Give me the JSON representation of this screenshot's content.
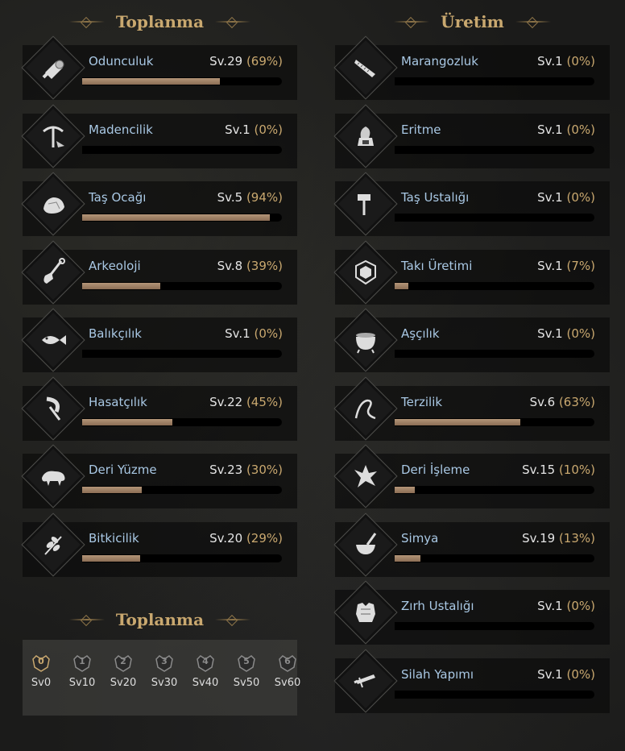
{
  "sections": {
    "gathering_title": "Toplanma",
    "production_title": "Üretim",
    "tiers_title": "Toplanma"
  },
  "gathering": [
    {
      "name": "Odunculuk",
      "level": "Sv.29",
      "percent": "(69%)",
      "progress": 0.69,
      "icon": "log-icon"
    },
    {
      "name": "Madencilik",
      "level": "Sv.1",
      "percent": "(0%)",
      "progress": 0.0,
      "icon": "pickaxe-icon"
    },
    {
      "name": "Taş Ocağı",
      "level": "Sv.5",
      "percent": "(94%)",
      "progress": 0.94,
      "icon": "stone-icon"
    },
    {
      "name": "Arkeoloji",
      "level": "Sv.8",
      "percent": "(39%)",
      "progress": 0.39,
      "icon": "shovel-icon"
    },
    {
      "name": "Balıkçılık",
      "level": "Sv.1",
      "percent": "(0%)",
      "progress": 0.0,
      "icon": "fish-icon"
    },
    {
      "name": "Hasatçılık",
      "level": "Sv.22",
      "percent": "(45%)",
      "progress": 0.45,
      "icon": "sickle-icon"
    },
    {
      "name": "Deri Yüzme",
      "level": "Sv.23",
      "percent": "(30%)",
      "progress": 0.3,
      "icon": "boar-icon"
    },
    {
      "name": "Bitkicilik",
      "level": "Sv.20",
      "percent": "(29%)",
      "progress": 0.29,
      "icon": "herb-icon"
    }
  ],
  "production": [
    {
      "name": "Marangozluk",
      "level": "Sv.1",
      "percent": "(0%)",
      "progress": 0.0,
      "icon": "saw-icon"
    },
    {
      "name": "Eritme",
      "level": "Sv.1",
      "percent": "(0%)",
      "progress": 0.0,
      "icon": "furnace-icon"
    },
    {
      "name": "Taş Ustalığı",
      "level": "Sv.1",
      "percent": "(0%)",
      "progress": 0.0,
      "icon": "hammer-icon"
    },
    {
      "name": "Takı Üretimi",
      "level": "Sv.1",
      "percent": "(7%)",
      "progress": 0.07,
      "icon": "gem-icon"
    },
    {
      "name": "Aşçılık",
      "level": "Sv.1",
      "percent": "(0%)",
      "progress": 0.0,
      "icon": "cauldron-icon"
    },
    {
      "name": "Terzilik",
      "level": "Sv.6",
      "percent": "(63%)",
      "progress": 0.63,
      "icon": "needle-icon"
    },
    {
      "name": "Deri İşleme",
      "level": "Sv.15",
      "percent": "(10%)",
      "progress": 0.1,
      "icon": "hide-icon"
    },
    {
      "name": "Simya",
      "level": "Sv.19",
      "percent": "(13%)",
      "progress": 0.13,
      "icon": "mortar-icon"
    },
    {
      "name": "Zırh Ustalığı",
      "level": "Sv.1",
      "percent": "(0%)",
      "progress": 0.0,
      "icon": "armor-icon"
    },
    {
      "name": "Silah Yapımı",
      "level": "Sv.1",
      "percent": "(0%)",
      "progress": 0.0,
      "icon": "sword-icon"
    }
  ],
  "tiers": [
    {
      "number": "0",
      "label": "Sv0",
      "active": true
    },
    {
      "number": "1",
      "label": "Sv10",
      "active": false
    },
    {
      "number": "2",
      "label": "Sv20",
      "active": false
    },
    {
      "number": "3",
      "label": "Sv30",
      "active": false
    },
    {
      "number": "4",
      "label": "Sv40",
      "active": false
    },
    {
      "number": "5",
      "label": "Sv50",
      "active": false
    },
    {
      "number": "6",
      "label": "Sv60",
      "active": false
    }
  ],
  "colors": {
    "title": "#c9a86f",
    "skill_name": "#a9c8e4",
    "percent": "#c9a86f",
    "progress_fill": "#a8896c",
    "tier_active": "#c9a86f"
  }
}
